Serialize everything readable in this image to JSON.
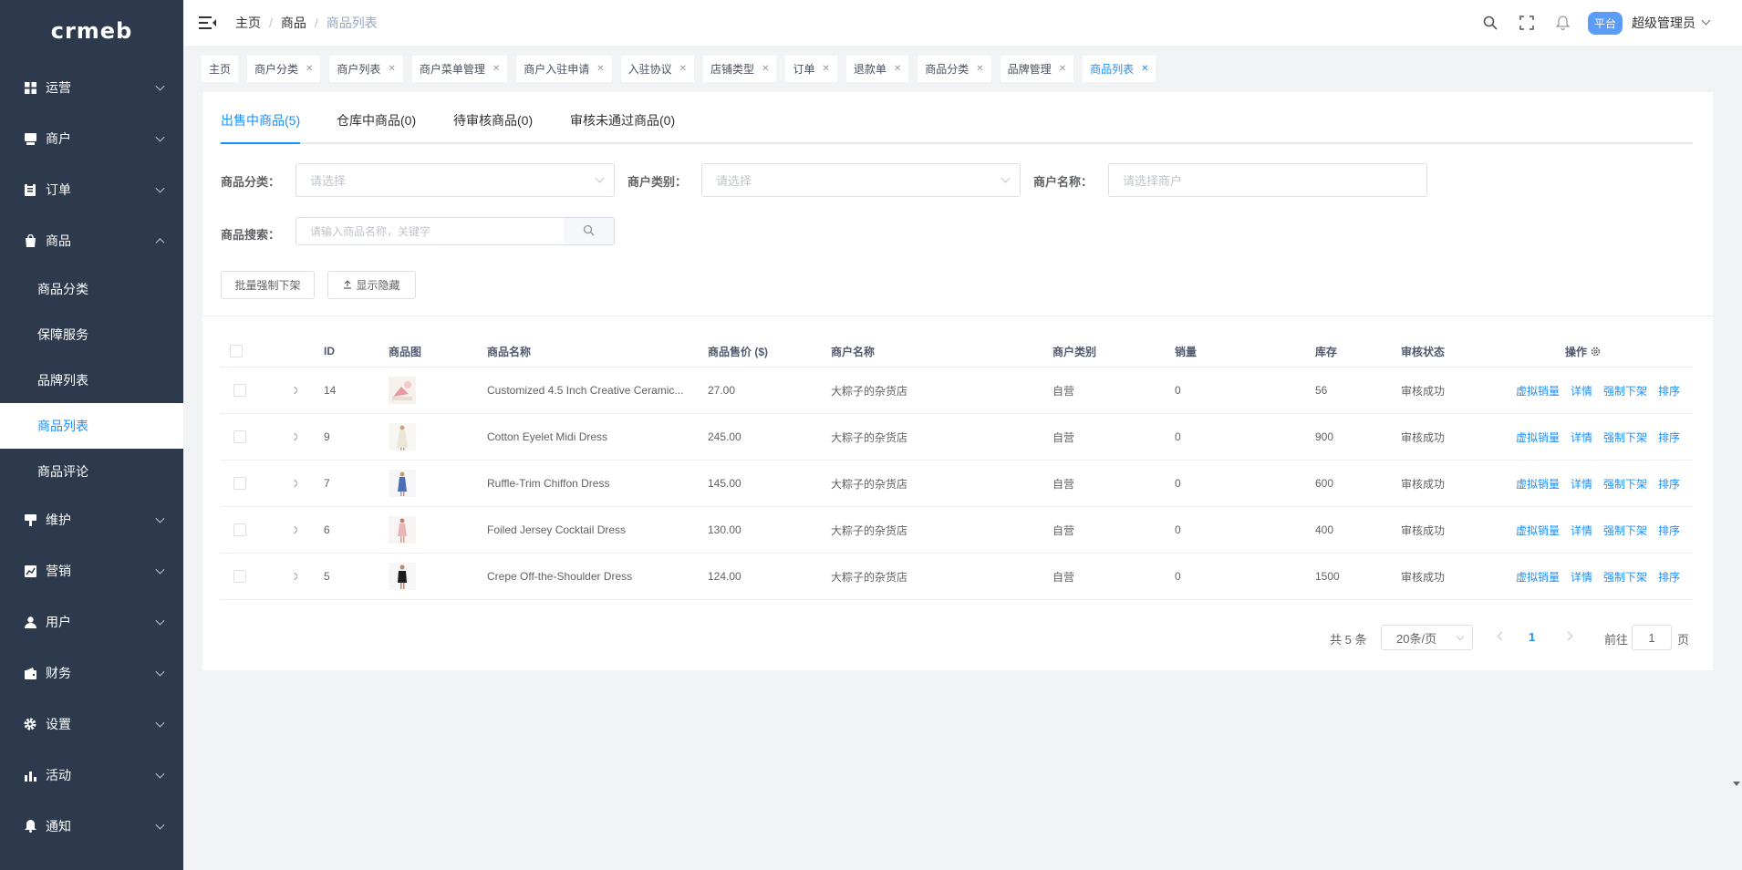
{
  "sidebar": {
    "logo": "crmeb",
    "menu_top": [
      {
        "label": "运营",
        "icon": "grid-icon"
      },
      {
        "label": "商户",
        "icon": "shop-icon"
      },
      {
        "label": "订单",
        "icon": "clipboard-icon"
      }
    ],
    "goods": {
      "label": "商品",
      "icon": "bag-icon"
    },
    "goods_children": [
      "商品分类",
      "保障服务",
      "品牌列表",
      "商品列表",
      "商品评论"
    ],
    "menu_bottom": [
      {
        "label": "维护",
        "icon": "wrench-icon"
      },
      {
        "label": "营销",
        "icon": "chart-icon"
      },
      {
        "label": "用户",
        "icon": "user-icon"
      },
      {
        "label": "财务",
        "icon": "wallet-icon"
      },
      {
        "label": "设置",
        "icon": "gear-icon"
      },
      {
        "label": "活动",
        "icon": "bar-chart-icon"
      },
      {
        "label": "通知",
        "icon": "bell-icon"
      }
    ]
  },
  "header": {
    "breadcrumb": [
      "主页",
      "商品",
      "商品列表"
    ],
    "badge": "平台",
    "admin": "超级管理员"
  },
  "tags": [
    "主页",
    "商户分类",
    "商户列表",
    "商户菜单管理",
    "商户入驻申请",
    "入驻协议",
    "店铺类型",
    "订单",
    "退款单",
    "商品分类",
    "品牌管理",
    "商品列表"
  ],
  "tabs": [
    "出售中商品(5)",
    "仓库中商品(0)",
    "待审核商品(0)",
    "审核未通过商品(0)"
  ],
  "filters": {
    "category_label": "商品分类：",
    "category_placeholder": "请选择",
    "merchant_type_label": "商户类别：",
    "merchant_type_placeholder": "请选择",
    "merchant_name_label": "商户名称：",
    "merchant_name_placeholder": "请选择商户",
    "search_label": "商品搜索：",
    "search_placeholder": "请输入商品名称，关键字"
  },
  "buttons": {
    "batch_off": "批量强制下架",
    "show_hidden": "显示隐藏"
  },
  "table": {
    "columns": [
      "ID",
      "商品图",
      "商品名称",
      "商品售价 ($)",
      "商户名称",
      "商户类别",
      "销量",
      "库存",
      "审核状态",
      "操作"
    ],
    "rows": [
      {
        "id": "14",
        "name": "Customized 4.5 Inch Creative Ceramic...",
        "price": "27.00",
        "merchant": "大粽子的杂货店",
        "type": "自营",
        "sales": "0",
        "stock": "56",
        "status": "审核成功"
      },
      {
        "id": "9",
        "name": "Cotton Eyelet Midi Dress",
        "price": "245.00",
        "merchant": "大粽子的杂货店",
        "type": "自营",
        "sales": "0",
        "stock": "900",
        "status": "审核成功"
      },
      {
        "id": "7",
        "name": "Ruffle-Trim Chiffon Dress",
        "price": "145.00",
        "merchant": "大粽子的杂货店",
        "type": "自营",
        "sales": "0",
        "stock": "600",
        "status": "审核成功"
      },
      {
        "id": "6",
        "name": "Foiled Jersey Cocktail Dress",
        "price": "130.00",
        "merchant": "大粽子的杂货店",
        "type": "自营",
        "sales": "0",
        "stock": "400",
        "status": "审核成功"
      },
      {
        "id": "5",
        "name": "Crepe Off-the-Shoulder Dress",
        "price": "124.00",
        "merchant": "大粽子的杂货店",
        "type": "自营",
        "sales": "0",
        "stock": "1500",
        "status": "审核成功"
      }
    ],
    "actions": [
      "虚拟销量",
      "详情",
      "强制下架",
      "排序"
    ]
  },
  "pagination": {
    "total": "共 5 条",
    "page_size": "20条/页",
    "current": "1",
    "goto_prefix": "前往",
    "goto_value": "1",
    "goto_suffix": "页"
  },
  "colors": {
    "sidebar_bg": "#2d3a4e",
    "accent": "#1890ff",
    "badge": "#5b9cf8"
  }
}
